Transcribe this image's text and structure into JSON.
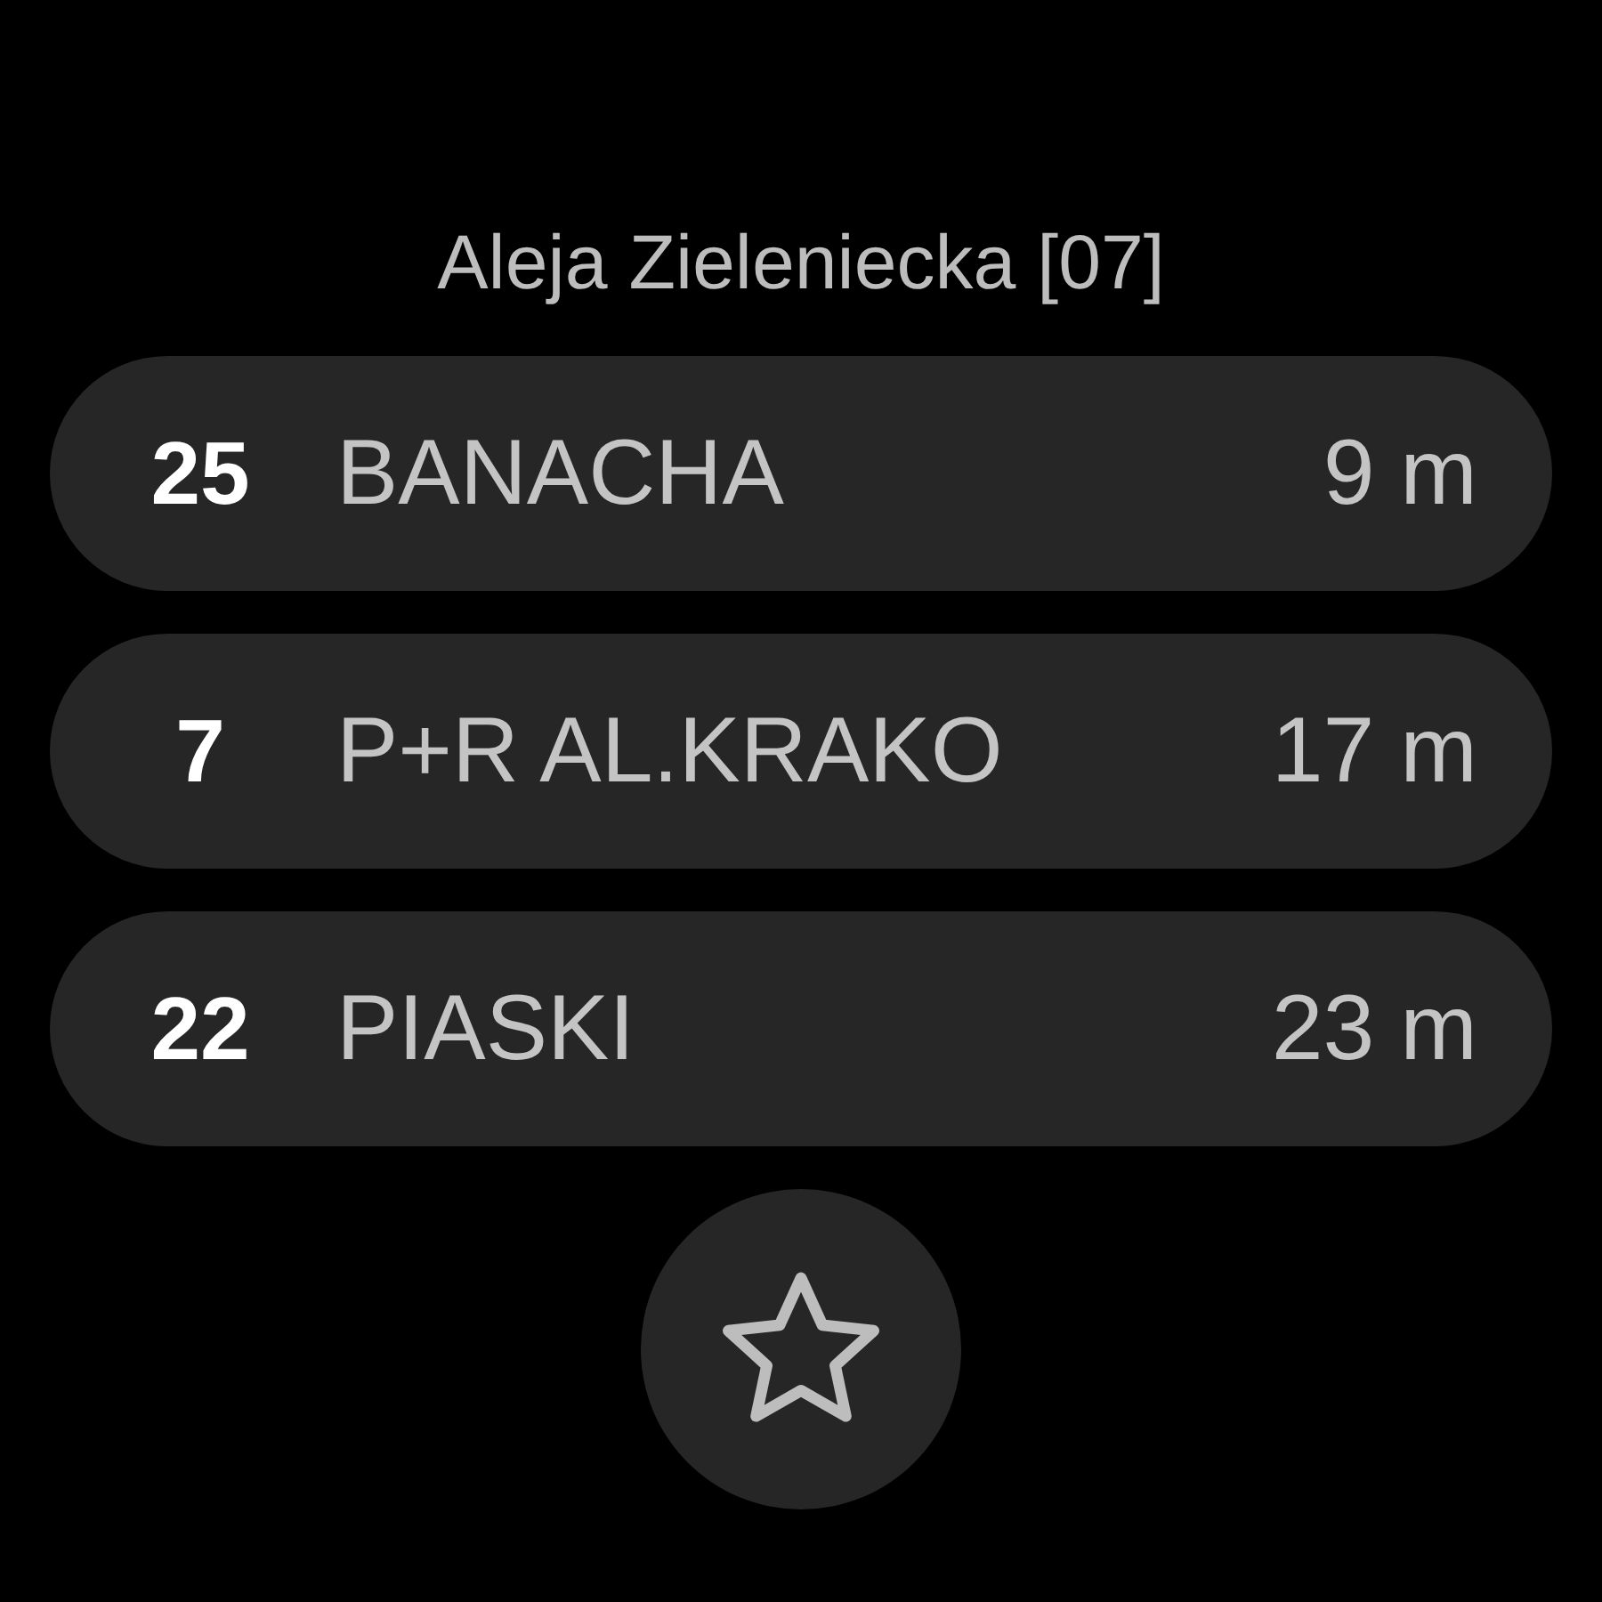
{
  "title": "Aleja Zieleniecka [07]",
  "departures": [
    {
      "line": "25",
      "destination": "BANACHA",
      "time": "9 m"
    },
    {
      "line": "7",
      "destination": "P+R AL.KRAKO",
      "time": "17 m"
    },
    {
      "line": "22",
      "destination": "PIASKI",
      "time": "23 m"
    }
  ],
  "favorite": {
    "selected": false
  }
}
